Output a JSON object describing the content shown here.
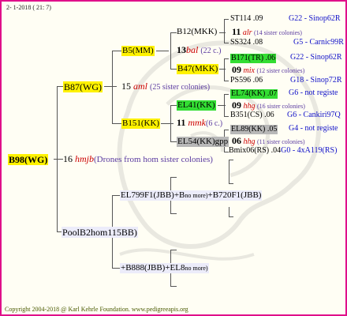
{
  "header": {
    "date_line": "2-  1-2018 ( 21:  7)"
  },
  "footer": {
    "copyright": "Copyright 2004-2018 @ Karl Kehrle Foundation.   www.pedigreeapis.org"
  },
  "root": {
    "name": "B98(WG)",
    "num": "16",
    "race": "hmjb",
    "note": "(Drones from hom sister colonies)"
  },
  "gen1_top": {
    "name": "B87(WG)",
    "num": "15",
    "race": "aml",
    "note": "(25 sister colonies)"
  },
  "gen1_bottom": {
    "name": "PoolB2hom115BB)"
  },
  "gen2": {
    "b5": {
      "name": "B5(MM)"
    },
    "b12": {
      "name": "B12(MKK)",
      "num": "13",
      "race": "bal",
      "note": "(22 c.)"
    },
    "b47": {
      "name": "B47(MKK)"
    },
    "b151": {
      "name": "B151(KK)",
      "num": "11",
      "race": "mmk",
      "note": "(6 c.)"
    },
    "el41": {
      "name": "EL41(KK)"
    },
    "el54": {
      "name": "EL54(KK)gpp"
    },
    "el799": {
      "name": "EL799F1(JBB)+B",
      "more": "no more)",
      "tail": "+B720F1(JBB)"
    },
    "b888": {
      "name": "+B888(JBB)+EL8",
      "more": "no more)"
    }
  },
  "right_rows": [
    {
      "name": "ST114",
      "year": ".09",
      "pos": "G22 - Sinop62R"
    },
    {
      "num": "11",
      "race": "alr",
      "note": "(14 sister colonies)"
    },
    {
      "name": "SS324",
      "year": ".08",
      "pos": "G5 - Carnic99R"
    },
    {
      "name": "B171(TR)",
      "year": ".06",
      "pos": "G22 - Sinop62R"
    },
    {
      "num": "09",
      "race": "mix",
      "note": "(12 sister colonies)"
    },
    {
      "name": "PS596",
      "year": ".06",
      "pos": "G18 - Sinop72R"
    },
    {
      "name": "EL74(KK)",
      "year": ".07",
      "pos": "G6 - not registe"
    },
    {
      "num": "09",
      "race": "hhg",
      "note": "(16 sister colonies)"
    },
    {
      "name": "B351(CS)",
      "year": ".06",
      "pos": "G6 - Cankiri97Q"
    },
    {
      "name": "EL89(KK)",
      "year": ".05",
      "pos": "G4 - not registe"
    },
    {
      "num": "06",
      "race": "hhg",
      "note": "(11 sister colonies)"
    },
    {
      "name": "Bmix06(RS)",
      "year": ".04",
      "pos": "G0 - 4xA119(RS)"
    }
  ],
  "colors": {
    "border": "#e0108a",
    "yellow": "#fff200",
    "green": "#33dd33",
    "gray": "#b8b8b8",
    "red": "#cc0000",
    "blue": "#1010c8"
  }
}
